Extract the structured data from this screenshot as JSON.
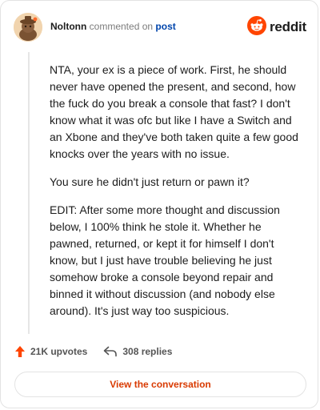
{
  "header": {
    "username": "Noltonn",
    "action_text": "commented on",
    "post_link": "post",
    "brand": "reddit",
    "avatar_icon": "avatar-icon",
    "brand_icon": "reddit-logo-icon"
  },
  "comment": {
    "paragraphs": [
      "NTA, your ex is a piece of work. First, he should never have opened the present, and second, how the fuck do you break a console that fast? I don't know what it was ofc but like I have a Switch and an Xbone and they've both taken quite a few good knocks over the years with no issue.",
      "You sure he didn't just return or pawn it?",
      "EDIT: After some more thought and discussion below, I 100% think he stole it. Whether he pawned, returned, or kept it for himself I don't know, but I just have trouble believing he just somehow broke a console beyond repair and binned it without discussion (and nobody else around). It's just way too suspicious."
    ]
  },
  "footer": {
    "upvotes": "21K upvotes",
    "replies": "308 replies",
    "upvote_icon": "upvote-arrow-icon",
    "reply_icon": "reply-arrow-icon"
  },
  "cta": {
    "label": "View the conversation"
  },
  "colors": {
    "brand_orange": "#ff4500",
    "link_blue": "#0045ac",
    "cta_text": "#d93a00",
    "border": "#e3e3e3"
  }
}
